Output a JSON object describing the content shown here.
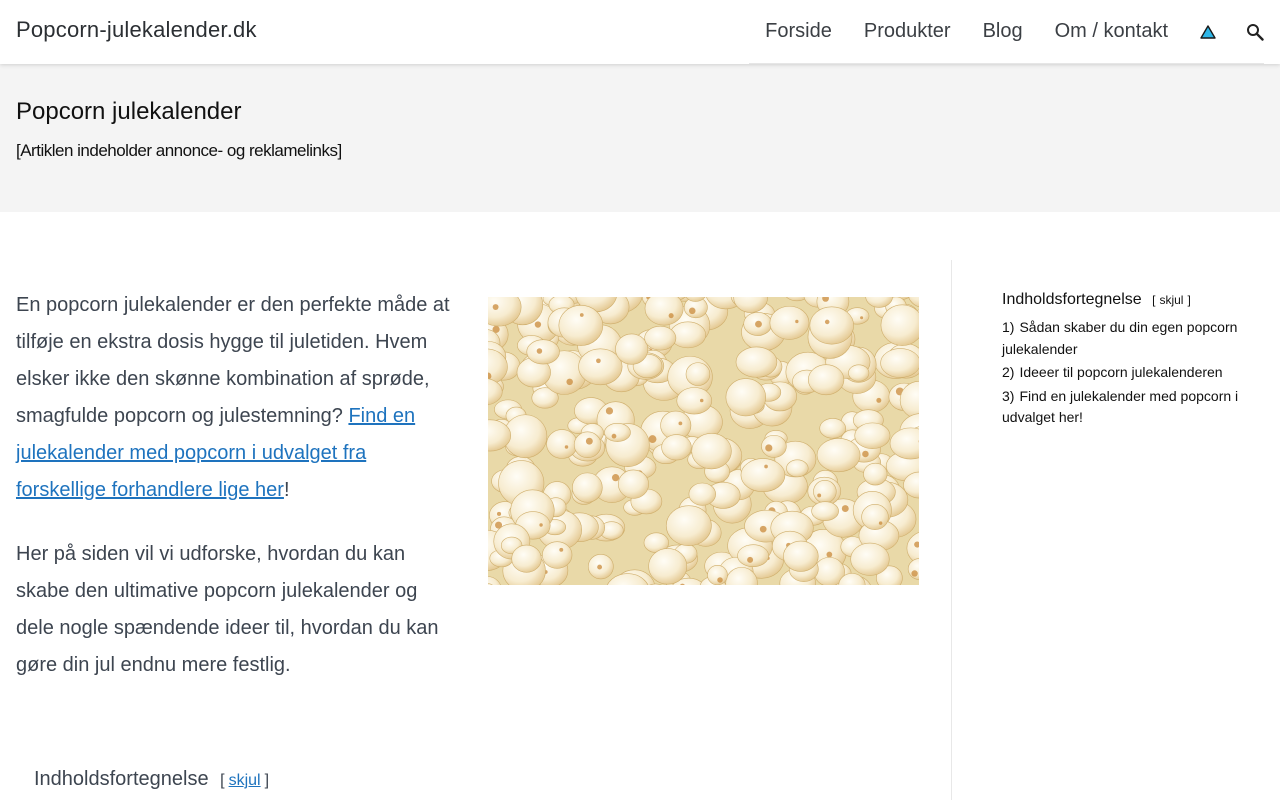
{
  "header": {
    "site_title": "Popcorn-julekalender.dk",
    "nav": [
      "Forside",
      "Produkter",
      "Blog",
      "Om / kontakt"
    ],
    "icons": [
      "warning-triangle-icon",
      "search-icon"
    ]
  },
  "band": {
    "title": "Popcorn julekalender",
    "disclaimer": "[Artiklen indeholder annonce- og reklamelinks]"
  },
  "main": {
    "para1_text": "En popcorn julekalender er den perfekte måde at tilføje en ekstra dosis hygge til juletiden. Hvem elsker ikke den skønne kombination af sprøde, smagfulde popcorn og julestemning? ",
    "para1_link": "Find en julekalender med popcorn i udvalget fra forskellige forhandlere lige her",
    "para1_end": "!",
    "para2": "Her på siden vil vi udforske, hvordan du kan skabe den ultimative popcorn julekalender og dele nogle spændende ideer til, hvordan du kan gøre din jul endnu mere festlig.",
    "toc_title": "Indholdsfortegnelse",
    "toc_bracket_open": "[",
    "toc_toggle": "skjul",
    "toc_bracket_close": "]"
  },
  "sidebar": {
    "toc_title": "Indholdsfortegnelse",
    "toc_bracket_open": "[",
    "toc_toggle": "skjul",
    "toc_bracket_close": "]",
    "items": [
      {
        "num": "1)",
        "label": "Sådan skaber du din egen popcorn julekalender"
      },
      {
        "num": "2)",
        "label": "Ideeer til popcorn julekalenderen"
      },
      {
        "num": "3)",
        "label": "Find en julekalender med popcorn i udvalget her!"
      }
    ]
  },
  "colors": {
    "link": "#1e73be",
    "band_bg": "#f4f4f4",
    "text": "#3d4550"
  }
}
